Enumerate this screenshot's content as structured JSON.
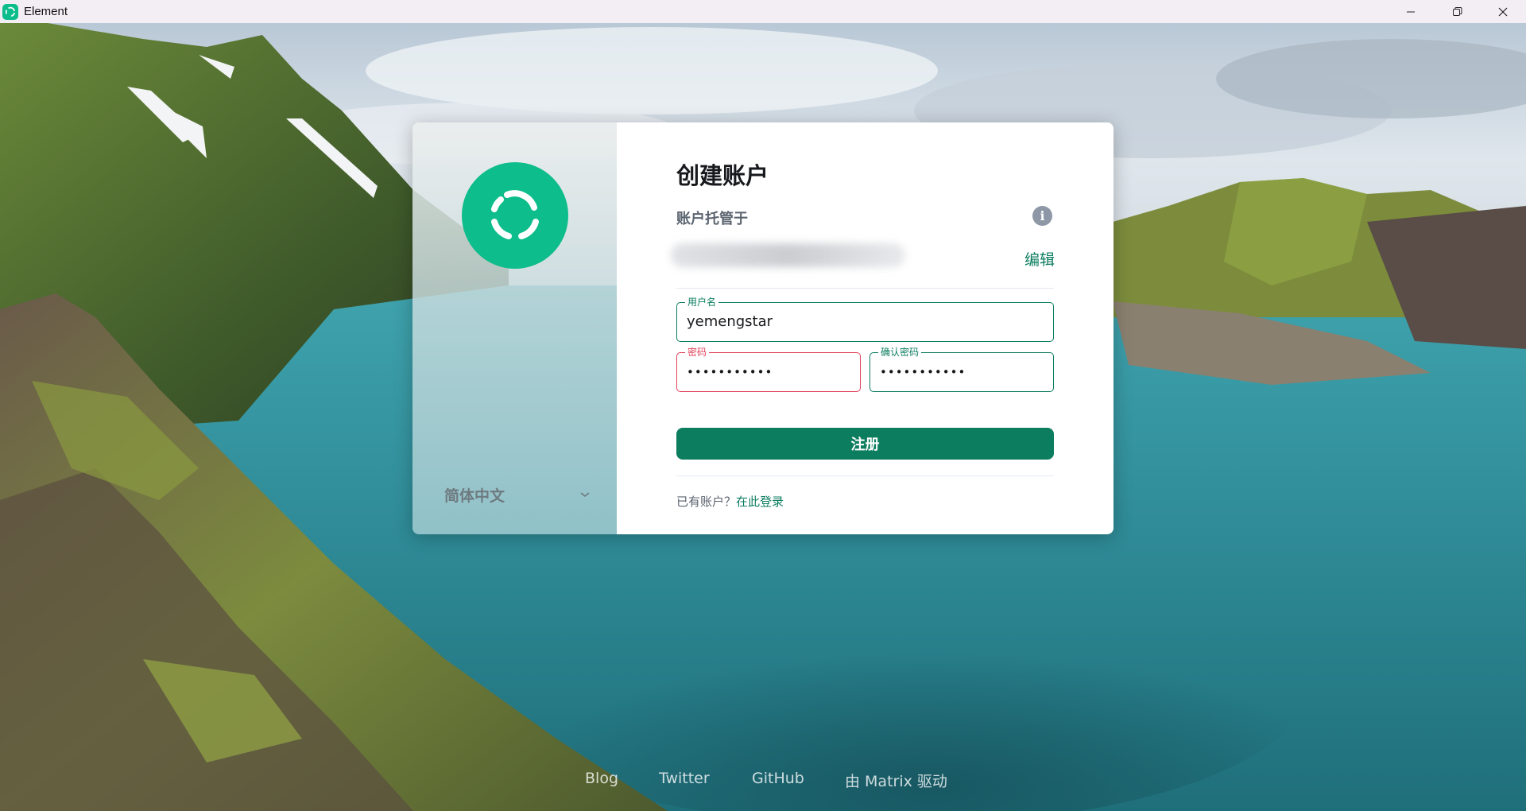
{
  "window": {
    "title": "Element",
    "controls": [
      "minimize",
      "restore",
      "close"
    ]
  },
  "dialog": {
    "language": "简体中文",
    "heading": "创建账户",
    "host_label": "账户托管于",
    "edit_label": "编辑",
    "fields": {
      "username": {
        "label": "用户名",
        "value": "yemengstar"
      },
      "password": {
        "label": "密码",
        "value": "•••••••••••"
      },
      "confirm_password": {
        "label": "确认密码",
        "value": "•••••••••••"
      }
    },
    "register_label": "注册",
    "have_account": "已有账户？",
    "login_link": "在此登录"
  },
  "footer": {
    "links": [
      "Blog",
      "Twitter",
      "GitHub",
      "由 Matrix 驱动"
    ]
  },
  "colors": {
    "accent": "#0dbd8b",
    "accent_dark": "#0c7d5f",
    "error": "#e0415a"
  }
}
